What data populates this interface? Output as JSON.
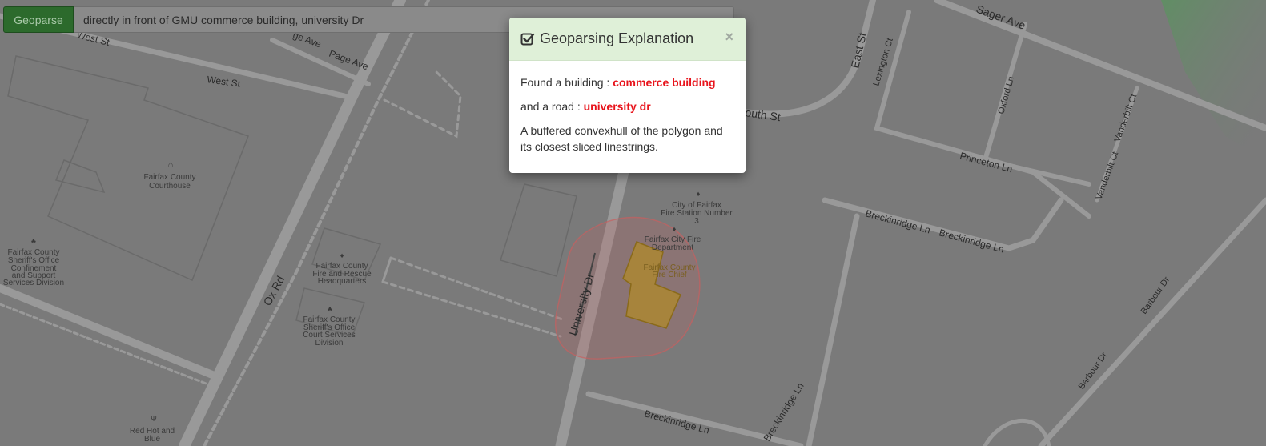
{
  "toolbar": {
    "button_label": "Geoparse",
    "query_value": "directly in front of GMU commerce building, university Dr"
  },
  "modal": {
    "title": "Geoparsing Explanation",
    "close_symbol": "×",
    "line1_prefix": "Found a building : ",
    "line1_value": "commerce building",
    "line2_prefix": "and a road : ",
    "line2_value": "university dr",
    "line3": "A buffered convexhull of the polygon and its closest sliced linestrings.",
    "icon": "check-square-icon"
  },
  "map": {
    "streets": {
      "west_st_a": "West St",
      "west_st_b": "West St",
      "page_ave": "Page Ave",
      "page_ave_partial": "ge Ave",
      "sager_ave": "Sager Ave",
      "east_st": "East St",
      "lexington_ct": "Lexington Ct",
      "oxford_ln": "Oxford Ln",
      "vanderbilt_ct_a": "Vanderbilt Ct",
      "vanderbilt_ct_b": "Vanderbilt Ct",
      "south_st": "outh St",
      "princeton_ln": "Princeton Ln",
      "breckinridge_a": "Breckinridge Ln",
      "breckinridge_b": "Breckinridge Ln",
      "breckinridge_c": "Breckinridge Ln",
      "breckinridge_d": "Breckinridge Ln",
      "ox_rd": "Ox Rd",
      "university_dr": "University Dr",
      "barbour_dr_a": "Barbour Dr",
      "barbour_dr_b": "Barbour Dr"
    },
    "pois": {
      "courthouse": [
        "Fairfax County",
        "Courthouse"
      ],
      "sheriff_confinement": [
        "Fairfax County",
        "Sheriff's Office",
        "Confinement",
        "and Support",
        "Services Division"
      ],
      "fire_rescue_hq": [
        "Fairfax County",
        "Fire and Rescue",
        "Headquarters"
      ],
      "sheriff_court": [
        "Fairfax County",
        "Sheriff's Office",
        "Court Services",
        "Division"
      ],
      "fire_station": [
        "City of Fairfax",
        "Fire Station Number",
        "3"
      ],
      "fire_department": [
        "Fairfax City Fire",
        "Department"
      ],
      "fire_chief": [
        "Fairfax County",
        "Fire Chief"
      ],
      "red_hot_blue": [
        "Red Hot and",
        "Blue"
      ]
    },
    "colors": {
      "background": "#7a7a7a",
      "road": "#959595",
      "building_highlight": "#b08a2a",
      "buffer": "#c86060",
      "park": "#5f8f63"
    }
  }
}
